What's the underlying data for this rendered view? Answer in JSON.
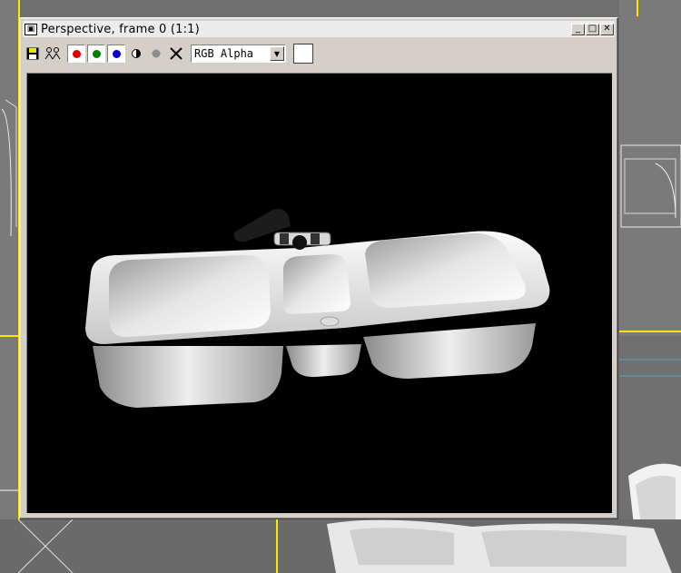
{
  "window": {
    "title": "Perspective, frame 0 (1:1)",
    "minimize_glyph": "_",
    "maximize_glyph": "□",
    "close_glyph": "✕"
  },
  "toolbar": {
    "channel_options": [
      "RGB Alpha"
    ],
    "channel_selected": "RGB Alpha",
    "swatch_color": "#ffffff",
    "red_channel_color": "#e00000",
    "green_channel_color": "#008000",
    "blue_channel_color": "#0000d0"
  },
  "icons": {
    "save": "save-icon",
    "clone": "clone-icon",
    "red": "red-channel-icon",
    "green": "green-channel-icon",
    "blue": "blue-channel-icon",
    "mono": "monochrome-icon",
    "alpha": "alpha-icon",
    "clear": "clear-icon"
  },
  "render": {
    "background_color": "#000000",
    "subject": "kitchen-sink"
  }
}
